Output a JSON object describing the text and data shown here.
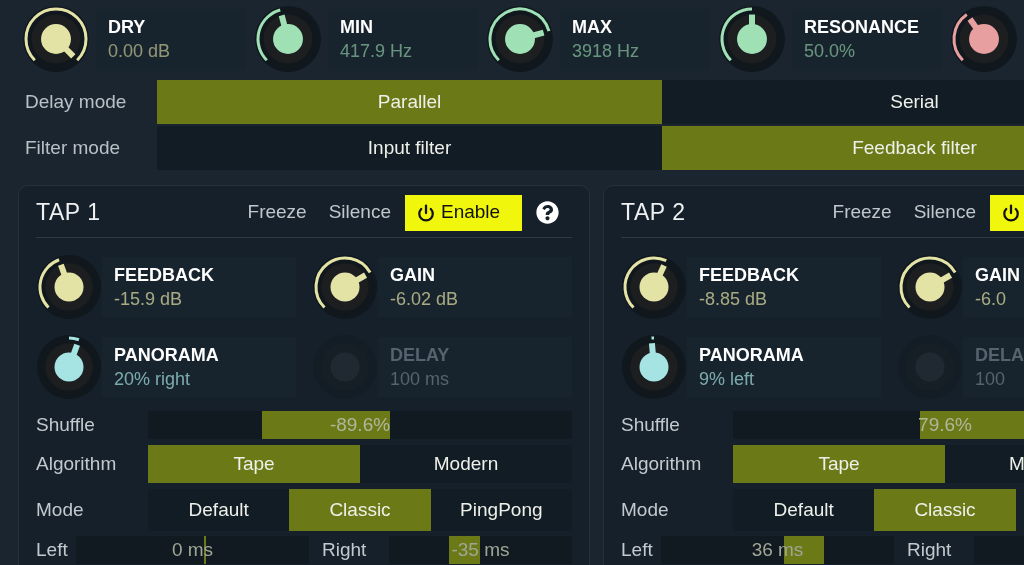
{
  "top_knobs": [
    {
      "label": "DRY",
      "value": "0.00 dB",
      "color": "#e4e3a6"
    },
    {
      "label": "MIN",
      "value": "417.9 Hz",
      "color": "#9fe0b5"
    },
    {
      "label": "MAX",
      "value": "3918 Hz",
      "color": "#9fe0b5"
    },
    {
      "label": "RESONANCE",
      "value": "50.0%",
      "color": "#9fe0b5"
    },
    {
      "color": "#e89f9f"
    }
  ],
  "mode_rows": [
    {
      "label": "Delay mode",
      "options": [
        {
          "label": "Parallel",
          "selected": true
        },
        {
          "label": "Serial",
          "selected": false
        }
      ]
    },
    {
      "label": "Filter mode",
      "options": [
        {
          "label": "Input filter",
          "selected": false
        },
        {
          "label": "Feedback filter",
          "selected": true
        }
      ]
    }
  ],
  "taps": [
    {
      "title": "TAP 1",
      "freeze": {
        "label": "Freeze",
        "on": false
      },
      "silence": {
        "label": "Silence",
        "on": false
      },
      "enable": {
        "label": "Enable",
        "on": true
      },
      "help_button": true,
      "knobs": [
        {
          "label": "FEEDBACK",
          "value": "-15.9 dB",
          "color": "#e4e3a6",
          "kind": "unipolar",
          "disabled": false
        },
        {
          "label": "GAIN",
          "value": "-6.02 dB",
          "color": "#e4e3a6",
          "kind": "unipolar",
          "disabled": false
        },
        {
          "label": "PANORAMA",
          "value": "20% right",
          "color": "#a6e3e3",
          "kind": "bipolar",
          "disabled": false
        },
        {
          "label": "DELAY",
          "value": "100 ms",
          "kind": "unipolar",
          "disabled": true
        }
      ],
      "shuffle": {
        "label": "Shuffle",
        "value": "-89.6%"
      },
      "algorithm": {
        "label": "Algorithm",
        "options": [
          {
            "label": "Tape",
            "selected": true
          },
          {
            "label": "Modern",
            "selected": false
          }
        ]
      },
      "mode": {
        "label": "Mode",
        "options": [
          {
            "label": "Default",
            "selected": false
          },
          {
            "label": "Classic",
            "selected": true
          },
          {
            "label": "PingPong",
            "selected": false
          }
        ]
      },
      "left": {
        "label": "Left",
        "value": "0 ms"
      },
      "right": {
        "label": "Right",
        "value": "-35 ms"
      }
    },
    {
      "title": "TAP 2",
      "freeze": {
        "label": "Freeze",
        "on": false
      },
      "silence": {
        "label": "Silence",
        "on": false
      },
      "enable": {
        "on": true
      },
      "knobs": [
        {
          "label": "FEEDBACK",
          "value": "-8.85 dB",
          "color": "#e4e3a6",
          "kind": "unipolar",
          "disabled": false
        },
        {
          "label": "GAIN",
          "value": "-6.0",
          "color": "#e4e3a6",
          "kind": "unipolar",
          "disabled": false
        },
        {
          "label": "PANORAMA",
          "value": "9% left",
          "color": "#a6e3e3",
          "kind": "bipolar",
          "disabled": false
        },
        {
          "label": "DELA",
          "value": "100",
          "kind": "unipolar",
          "disabled": true
        }
      ],
      "shuffle": {
        "label": "Shuffle",
        "value": "79.6%"
      },
      "algorithm": {
        "label": "Algorithm",
        "options": [
          {
            "label": "Tape",
            "selected": true
          },
          {
            "label": "M",
            "selected": false
          }
        ]
      },
      "mode": {
        "label": "Mode",
        "options": [
          {
            "label": "Default",
            "selected": false
          },
          {
            "label": "Classic",
            "selected": true
          }
        ]
      },
      "left": {
        "label": "Left",
        "value": "36 ms"
      },
      "right": {
        "label": "Right"
      }
    }
  ]
}
